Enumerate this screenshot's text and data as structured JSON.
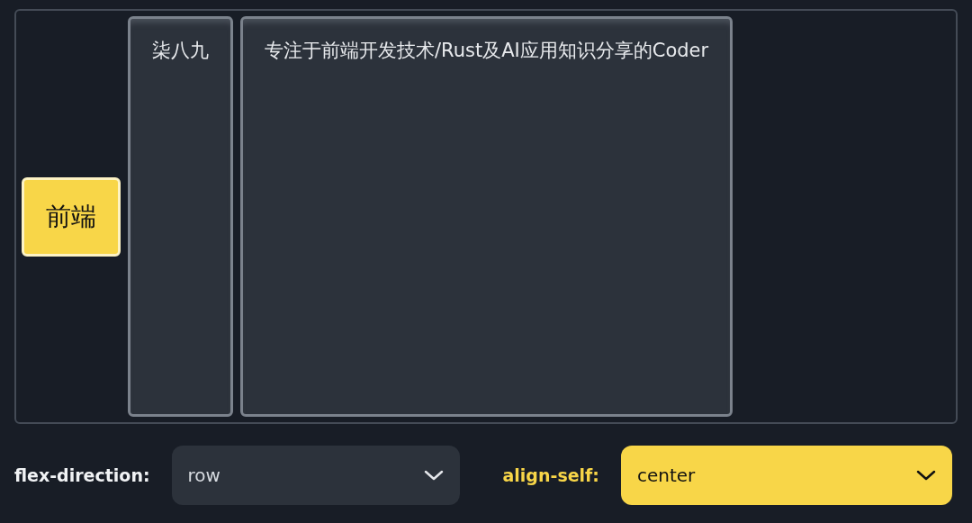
{
  "items": [
    {
      "text": "前端",
      "highlighted": true
    },
    {
      "text": "柒八九",
      "highlighted": false
    },
    {
      "text": "专注于前端开发技术/Rust及AI应用知识分享的Coder",
      "highlighted": false
    }
  ],
  "controls": [
    {
      "label": "flex-direction:",
      "value": "row",
      "active": false
    },
    {
      "label": "align-self:",
      "value": "center",
      "active": true
    }
  ]
}
